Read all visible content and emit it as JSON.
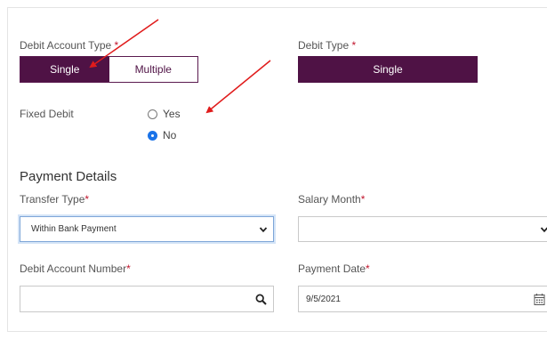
{
  "debit_account_type": {
    "label": "Debit Account Type",
    "required_mark": "*",
    "options": [
      {
        "label": "Single",
        "active": true
      },
      {
        "label": "Multiple",
        "active": false
      }
    ]
  },
  "debit_type": {
    "label": "Debit Type",
    "required_mark": "*",
    "value": "Single"
  },
  "fixed_debit": {
    "label": "Fixed Debit",
    "options": [
      {
        "label": "Yes",
        "checked": false
      },
      {
        "label": "No",
        "checked": true
      }
    ]
  },
  "payment_details": {
    "title": "Payment Details",
    "transfer_type": {
      "label": "Transfer Type",
      "required_mark": "*",
      "value": "Within Bank Payment"
    },
    "salary_month": {
      "label": "Salary Month",
      "required_mark": "*",
      "value": ""
    },
    "debit_account_number": {
      "label": "Debit Account Number",
      "required_mark": "*",
      "value": ""
    },
    "payment_date": {
      "label": "Payment Date",
      "required_mark": "*",
      "value": "9/5/2021"
    }
  },
  "colors": {
    "brand": "#4f1245",
    "required": "#c0142c",
    "annotation_arrow": "#e01b1b",
    "radio_checked": "#1a73e8"
  },
  "icons": {
    "search": "search-icon",
    "calendar": "calendar-icon",
    "dropdown": "chevron-down-icon"
  }
}
